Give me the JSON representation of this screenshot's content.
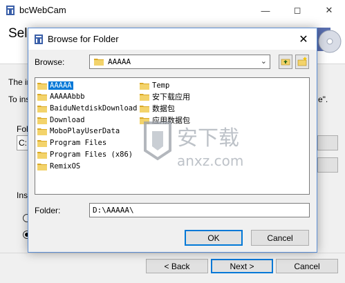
{
  "window": {
    "title": "bcWebCam"
  },
  "header": {
    "heading": "Sel"
  },
  "page": {
    "line1": "The in",
    "line2": "To ins",
    "line2_tail": "e\".",
    "folder_label": "Fold",
    "folder_value": "C:",
    "install_label": "Inst"
  },
  "nav": {
    "back": "< Back",
    "next": "Next >",
    "cancel": "Cancel"
  },
  "dialog": {
    "title": "Browse for Folder",
    "browse_label": "Browse:",
    "browse_value": "AAAAA",
    "folder_label": "Folder:",
    "folder_value": "D:\\AAAAA\\",
    "ok": "OK",
    "cancel": "Cancel",
    "items_left": [
      "AAAAA",
      "AAAAAbbb",
      "BaiduNetdiskDownload",
      "Download",
      "MoboPlayUserData",
      "Program Files",
      "Program Files (x86)",
      "RemixOS"
    ],
    "items_right": [
      "Temp",
      "安下载应用",
      "数据包",
      "应用数据包"
    ],
    "selected": "AAAAA"
  },
  "watermark": {
    "cn": "安下载",
    "en": "anxz.com"
  },
  "colors": {
    "accent": "#0078d7",
    "folder": "#f3d36b",
    "folder_dark": "#d9a825"
  }
}
